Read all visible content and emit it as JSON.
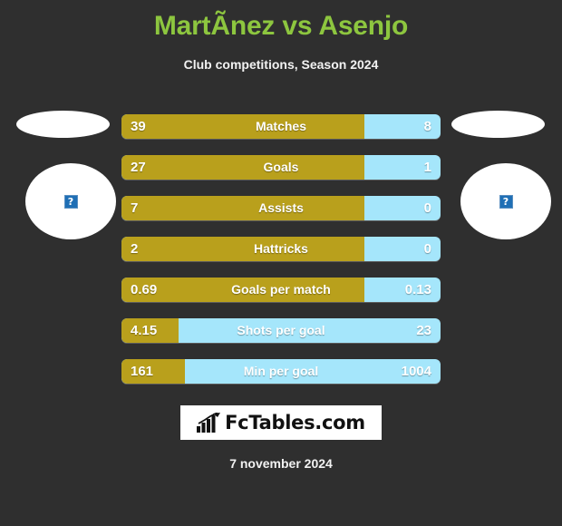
{
  "header": {
    "title": "MartÃ­nez vs Asenjo",
    "subtitle": "Club competitions, Season 2024"
  },
  "avatars": {
    "left": {
      "placeholder_glyph": "?",
      "name": "broken-image-placeholder"
    },
    "right": {
      "placeholder_glyph": "?",
      "name": "broken-image-placeholder"
    }
  },
  "colors": {
    "background": "#2f2f2f",
    "title": "#8dc63f",
    "home_bar": "#b9a01c",
    "away_bar": "#a5e6fb",
    "text": "#ffffff",
    "logo_background": "#ffffff"
  },
  "chart_data": {
    "type": "bar",
    "title": "MartÃ­nez vs Asenjo",
    "subtitle": "Club competitions, Season 2024",
    "orientation": "horizontal-diverging",
    "series": [
      {
        "name": "MartÃ­nez",
        "color": "#b9a01c",
        "side": "left"
      },
      {
        "name": "Asenjo",
        "color": "#a5e6fb",
        "side": "right"
      }
    ],
    "categories": [
      "Matches",
      "Goals",
      "Assists",
      "Hattricks",
      "Goals per match",
      "Shots per goal",
      "Min per goal"
    ],
    "rows": [
      {
        "label": "Matches",
        "home": "39",
        "away": "8",
        "home_pct": 76
      },
      {
        "label": "Goals",
        "home": "27",
        "away": "1",
        "home_pct": 76
      },
      {
        "label": "Assists",
        "home": "7",
        "away": "0",
        "home_pct": 76
      },
      {
        "label": "Hattricks",
        "home": "2",
        "away": "0",
        "home_pct": 76
      },
      {
        "label": "Goals per match",
        "home": "0.69",
        "away": "0.13",
        "home_pct": 76
      },
      {
        "label": "Shots per goal",
        "home": "4.15",
        "away": "23",
        "home_pct": 18
      },
      {
        "label": "Min per goal",
        "home": "161",
        "away": "1004",
        "home_pct": 20
      }
    ],
    "grid": false,
    "legend": "none"
  },
  "footer": {
    "logo_text": "FcTables.com",
    "logo_icon": "bar-chart-arrow-icon",
    "date": "7 november 2024"
  }
}
